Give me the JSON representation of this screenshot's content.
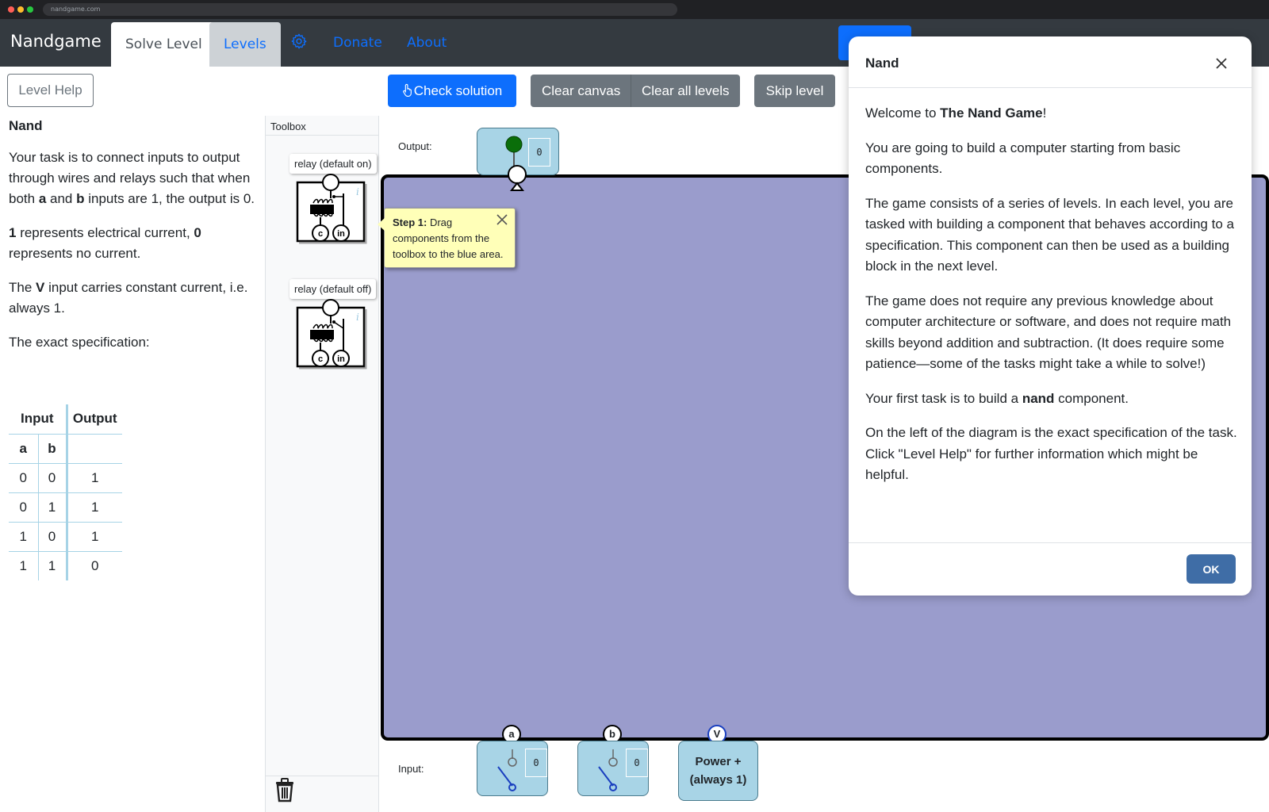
{
  "browser": {
    "url": "nandgame.com"
  },
  "nav": {
    "brand": "Nandgame",
    "tabs": [
      {
        "label": "Solve Level",
        "active": true
      },
      {
        "label": "Levels",
        "active": false
      }
    ],
    "settings_icon": "gear-icon",
    "links": [
      "Donate",
      "About"
    ]
  },
  "left": {
    "help_button": "Level Help",
    "title": "Nand",
    "p1": {
      "t1": "Your task is to connect inputs to output through wires and relays such that when both ",
      "a": "a",
      "t2": " and ",
      "b": "b",
      "t3": " inputs are 1, the output is 0."
    },
    "p2": {
      "one": "1",
      "t1": " represents electrical current, ",
      "zero": "0",
      "t2": " represents no current."
    },
    "p3": {
      "t1": "The ",
      "v": "V",
      "t2": " input carries constant current, i.e. always 1."
    },
    "p4": "The exact specification:",
    "spec": {
      "header_input": "Input",
      "header_output": "Output",
      "col_a": "a",
      "col_b": "b",
      "rows": [
        [
          "0",
          "0",
          "1"
        ],
        [
          "0",
          "1",
          "1"
        ],
        [
          "1",
          "0",
          "1"
        ],
        [
          "1",
          "1",
          "0"
        ]
      ]
    }
  },
  "toolbar": {
    "check": "Check solution",
    "clear_canvas": "Clear canvas",
    "clear_all": "Clear all levels",
    "skip": "Skip level"
  },
  "toolbox": {
    "title": "Toolbox",
    "items": [
      "relay (default on)",
      "relay (default off)"
    ],
    "relay_pins": [
      "c",
      "in"
    ],
    "info_glyph": "i",
    "trash_icon": "trash-icon"
  },
  "diagram": {
    "output_label": "Output:",
    "input_label": "Input:",
    "output_value": "0",
    "inputs": [
      {
        "pin": "a",
        "value": "0"
      },
      {
        "pin": "b",
        "value": "0"
      }
    ],
    "power": {
      "pin": "V",
      "line1": "Power +",
      "line2": "(always 1)"
    }
  },
  "tooltip": {
    "step": "Step 1:",
    "text": " Drag components from the toolbox to the blue area."
  },
  "modal": {
    "title": "Nand",
    "welcome": {
      "t1": "Welcome to ",
      "b": "The Nand Game",
      "t2": "!"
    },
    "p2": "You are going to build a computer starting from basic components.",
    "p3": "The game consists of a series of levels. In each level, you are tasked with building a component that behaves according to a specification. This component can then be used as a building block in the next level.",
    "p4": "The game does not require any previous knowledge about computer architecture or software, and does not require math skills beyond addition and subtraction. (It does require some patience—some of the tasks might take a while to solve!)",
    "p5": {
      "t1": "Your first task is to build a ",
      "b": "nand",
      "t2": " component."
    },
    "p6": "On the left of the diagram is the exact specification of the task. Click \"Level Help\" for further information which might be helpful.",
    "ok": "OK"
  },
  "colors": {
    "navbar": "#343a40",
    "primary": "#0d6efd",
    "secondary": "#6c757d",
    "canvas": "#9a9ccc",
    "node": "#a8d4e6",
    "tooltip": "#ffffb8",
    "ok_button": "#3f6da6",
    "output_on": "#0a6e0a"
  }
}
